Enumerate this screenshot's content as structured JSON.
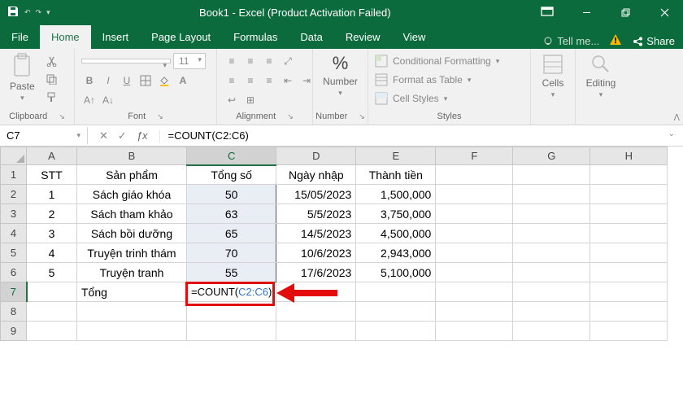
{
  "titlebar": {
    "title": "Book1 - Excel (Product Activation Failed)"
  },
  "tabs": {
    "file": "File",
    "home": "Home",
    "insert": "Insert",
    "page_layout": "Page Layout",
    "formulas": "Formulas",
    "data": "Data",
    "review": "Review",
    "view": "View",
    "tell_me": "Tell me...",
    "share": "Share"
  },
  "ribbon": {
    "paste": "Paste",
    "clipboard": "Clipboard",
    "font": "Font",
    "font_size": "11",
    "alignment": "Alignment",
    "number": "Number",
    "percent": "%",
    "cond_format": "Conditional Formatting",
    "format_table": "Format as Table",
    "cell_styles": "Cell Styles",
    "styles": "Styles",
    "cells": "Cells",
    "editing": "Editing"
  },
  "namebox": {
    "cell": "C7",
    "formula": "=COUNT(C2:C6)"
  },
  "cols": [
    "A",
    "B",
    "C",
    "D",
    "E",
    "F",
    "G",
    "H"
  ],
  "rows": [
    "1",
    "2",
    "3",
    "4",
    "5",
    "6",
    "7",
    "8",
    "9"
  ],
  "headers": {
    "A": "STT",
    "B": "Sản phẩm",
    "C": "Tổng số",
    "D": "Ngày nhập",
    "E": "Thành tiền"
  },
  "data": [
    {
      "stt": "1",
      "sp": "Sách giáo khóa",
      "ts": "50",
      "ng": "15/05/2023",
      "tt": "1,500,000"
    },
    {
      "stt": "2",
      "sp": "Sách tham khảo",
      "ts": "63",
      "ng": "5/5/2023",
      "tt": "3,750,000"
    },
    {
      "stt": "3",
      "sp": "Sách bồi dưỡng",
      "ts": "65",
      "ng": "14/5/2023",
      "tt": "4,500,000"
    },
    {
      "stt": "4",
      "sp": "Truyện trinh thám",
      "ts": "70",
      "ng": "10/6/2023",
      "tt": "2,943,000"
    },
    {
      "stt": "5",
      "sp": "Truyện tranh",
      "ts": "55",
      "ng": "17/6/2023",
      "tt": "5,100,000"
    }
  ],
  "total_row": {
    "label": "Tổng",
    "formula_prefix": "=COUNT(",
    "formula_range": "C2:C6",
    "formula_suffix": ")"
  }
}
